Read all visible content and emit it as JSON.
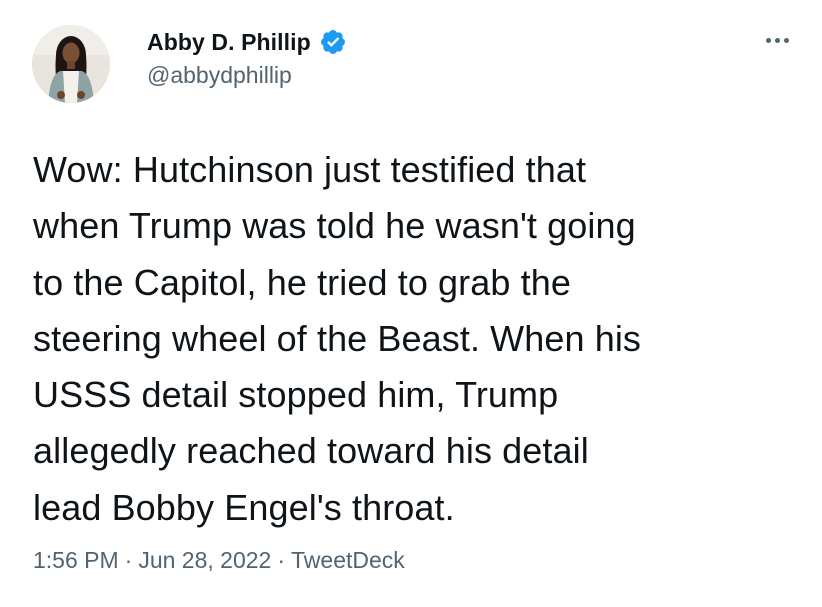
{
  "author": {
    "display_name": "Abby D. Phillip",
    "handle": "@abbydphillip",
    "verified": true,
    "avatar_icon": "profile-photo",
    "verified_icon": "verified-badge-icon",
    "more_icon": "more-options-icon"
  },
  "tweet": {
    "lines": [
      "Wow: Hutchinson just testified that",
      "when Trump was told he wasn't going",
      "to the Capitol, he tried to grab the",
      "steering wheel of the Beast. When his",
      "USSS detail stopped him, Trump",
      "allegedly reached toward his detail",
      "lead Bobby Engel's throat."
    ]
  },
  "meta": {
    "time": "1:56 PM",
    "separator": "·",
    "date": "Jun 28, 2022",
    "source": "TweetDeck"
  },
  "colors": {
    "text": "#0f1419",
    "secondary": "#536471",
    "verified": "#1d9bf0"
  }
}
